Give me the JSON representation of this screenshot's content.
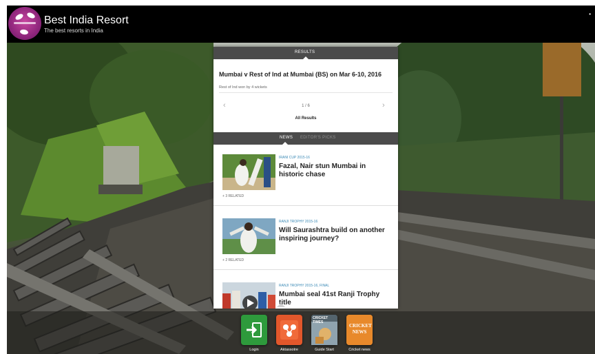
{
  "header": {
    "title": "Best India Resort",
    "tagline": "The best resorts in India",
    "corner_mark": "•"
  },
  "panel": {
    "results_tab": "RESULTS",
    "match_title": "Mumbai v Rest of Ind at Mumbai (BS) on Mar 6-10, 2016",
    "match_result": "Rest of Ind won by 4 wickets",
    "pager": "1 / 6",
    "all_results": "All Results",
    "news_tab": "NEWS",
    "second_tab": "EDITOR'S PICKS",
    "stories": [
      {
        "category": "IRANI CUP 2015-16",
        "headline": "Fazal, Nair stun Mumbai in historic chase",
        "related": "3 RELATED"
      },
      {
        "category": "RANJI TROPHY 2015-16",
        "headline": "Will Saurashtra build on another inspiring journey?",
        "related": "2 RELATED"
      },
      {
        "category": "RANJI TROPHY 2015-16, FINAL",
        "headline": "Mumbai seal 41st Ranji Trophy title",
        "related": ""
      }
    ]
  },
  "dock": {
    "apps": [
      {
        "label": "Login",
        "icon": "login-icon",
        "color": "#2e9a3c"
      },
      {
        "label": "Aktassotre",
        "icon": "people-share-icon",
        "color": "#e2572b"
      },
      {
        "label": "Guide Start",
        "icon": "cricket-times-icon",
        "color": "#6d7f8a"
      },
      {
        "label": "Cricket news",
        "icon": "cricket-news-icon",
        "color": "#e8892b"
      }
    ],
    "cricket_times_text": "CRICKET TIMES",
    "cricket_news_text": "CRICKET NEWS"
  }
}
